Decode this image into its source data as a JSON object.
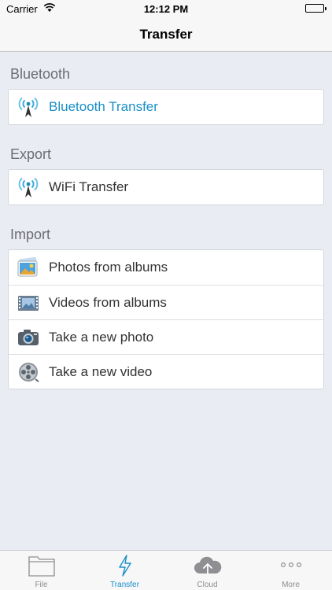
{
  "status_bar": {
    "carrier": "Carrier",
    "time": "12:12 PM"
  },
  "nav": {
    "title": "Transfer"
  },
  "sections": [
    {
      "header": "Bluetooth",
      "items": [
        {
          "label": "Bluetooth Transfer",
          "icon": "antenna-icon"
        }
      ]
    },
    {
      "header": "Export",
      "items": [
        {
          "label": "WiFi Transfer",
          "icon": "antenna-icon"
        }
      ]
    },
    {
      "header": "Import",
      "items": [
        {
          "label": "Photos from albums",
          "icon": "photos-icon"
        },
        {
          "label": "Videos from albums",
          "icon": "film-icon"
        },
        {
          "label": "Take a new photo",
          "icon": "camera-icon"
        },
        {
          "label": "Take a new video",
          "icon": "film-reel-icon"
        }
      ]
    }
  ],
  "tabs": [
    {
      "label": "File",
      "icon": "folder-icon"
    },
    {
      "label": "Transfer",
      "icon": "lightning-icon",
      "active": true
    },
    {
      "label": "Cloud",
      "icon": "cloud-upload-icon"
    },
    {
      "label": "More",
      "icon": "more-dots-icon"
    }
  ],
  "colors": {
    "accent": "#1a8fc6",
    "background": "#e9ecf2"
  }
}
